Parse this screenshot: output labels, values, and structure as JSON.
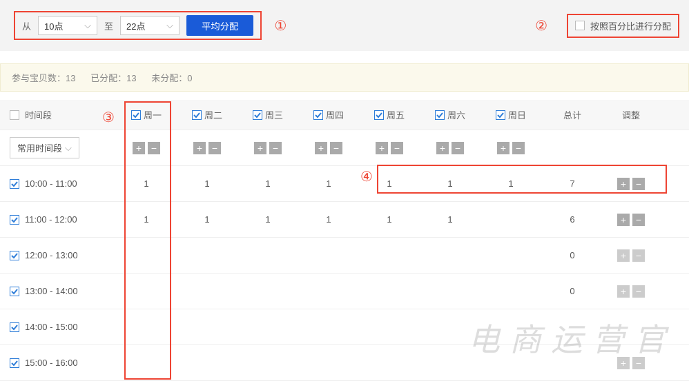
{
  "top": {
    "from_label": "从",
    "from_value": "10点",
    "to_label": "至",
    "to_value": "22点",
    "distribute_btn": "平均分配",
    "pct_label": "按照百分比进行分配"
  },
  "annotations": {
    "a1": "①",
    "a2": "②",
    "a3": "③",
    "a4": "④"
  },
  "stats": {
    "participating": "参与宝贝数：13",
    "allocated": "已分配：13",
    "unallocated": "未分配：0"
  },
  "headers": {
    "time": "时间段",
    "days": [
      "周一",
      "周二",
      "周三",
      "周四",
      "周五",
      "周六",
      "周日"
    ],
    "total": "总计",
    "adjust": "调整"
  },
  "common_time_btn": "常用时间段",
  "rows": [
    {
      "time": "10:00 - 11:00",
      "vals": [
        "1",
        "1",
        "1",
        "1",
        "1",
        "1",
        "1"
      ],
      "total": "7"
    },
    {
      "time": "11:00 - 12:00",
      "vals": [
        "1",
        "1",
        "1",
        "1",
        "1",
        "1",
        ""
      ],
      "total": "6"
    },
    {
      "time": "12:00 - 13:00",
      "vals": [
        "",
        "",
        "",
        "",
        "",
        "",
        ""
      ],
      "total": "0"
    },
    {
      "time": "13:00 - 14:00",
      "vals": [
        "",
        "",
        "",
        "",
        "",
        "",
        ""
      ],
      "total": "0"
    },
    {
      "time": "14:00 - 15:00",
      "vals": [
        "",
        "",
        "",
        "",
        "",
        "",
        ""
      ],
      "total": ""
    },
    {
      "time": "15:00 - 16:00",
      "vals": [
        "",
        "",
        "",
        "",
        "",
        "",
        ""
      ],
      "total": ""
    }
  ],
  "watermark": "电商运营官"
}
